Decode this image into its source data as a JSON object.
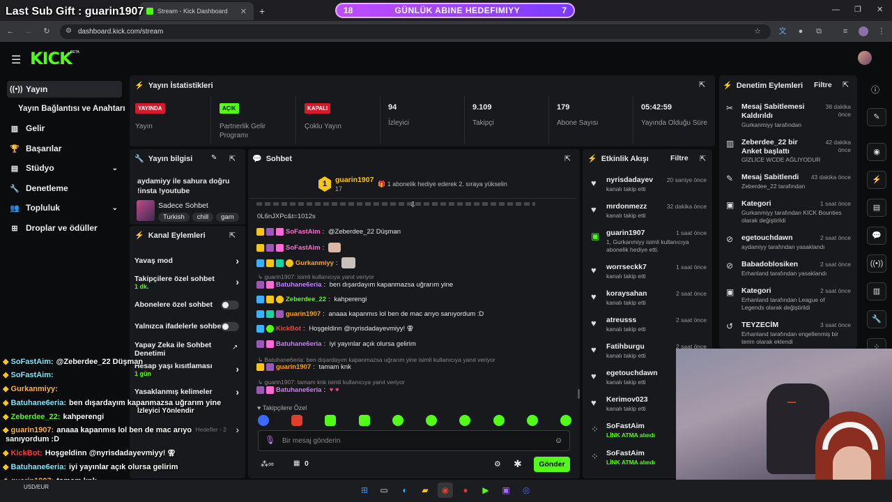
{
  "browser": {
    "tabs": [
      {
        "title": "Stream - Kick Dashboard"
      }
    ],
    "url": "dashboard.kick.com/stream"
  },
  "overlay": {
    "last_gift": "Last Sub Gift : guarin1907",
    "goal_left": "18",
    "goal_text": "GÜNLÜK ABINE HEDEFIMIYY",
    "goal_right": "7"
  },
  "header": {
    "logo": "KICK",
    "beta": "BETA"
  },
  "sidebar": {
    "items": [
      {
        "label": "Yayın"
      },
      {
        "label": "Yayın Bağlantısı ve Anahtarı"
      },
      {
        "label": "Gelir"
      },
      {
        "label": "Başarılar"
      },
      {
        "label": "Stüdyo"
      },
      {
        "label": "Denetleme"
      },
      {
        "label": "Topluluk"
      },
      {
        "label": "Droplar ve ödüller"
      }
    ]
  },
  "stats": {
    "title": "Yayın İstatistikleri",
    "cells": [
      {
        "badge": "YAYINDA",
        "label": "Yayın"
      },
      {
        "badge": "AÇIK",
        "label": "Partnerlik Gelir Programı"
      },
      {
        "badge": "KAPALI",
        "label": "Çoklu Yayın"
      },
      {
        "value": "94",
        "label": "İzleyici"
      },
      {
        "value": "9.109",
        "label": "Takipçi"
      },
      {
        "value": "179",
        "label": "Abone Sayısı"
      },
      {
        "value": "05:42:59",
        "label": "Yayında Olduğu Süre"
      }
    ]
  },
  "yayin_bilgisi": {
    "title": "Yayın bilgisi",
    "stream_title": "aydamiyy ile sahura doğru !insta !youtube",
    "category": "Sadece Sohbet",
    "tags": [
      "Turkish",
      "chill",
      "gam"
    ]
  },
  "kanal": {
    "title": "Kanal Eylemleri",
    "items": [
      {
        "label": "Yavaş mod"
      },
      {
        "label": "Takipçilere özel sohbet",
        "sub": "1 dk."
      },
      {
        "label": "Abonelere özel sohbet"
      },
      {
        "label": "Yalnızca ifadelerle sohbet"
      },
      {
        "label": "Yapay Zeka ile Sohbet Denetimi"
      },
      {
        "label": "Hesap yaşı kısıtlaması",
        "sub": "1 gün"
      },
      {
        "label": "Yasaklanmış kelimeler"
      },
      {
        "label": "Hedefler - 2"
      }
    ]
  },
  "chat": {
    "title": "Sohbet",
    "pinned_user": "guarin1907",
    "pinned_count": "17",
    "pinned_rank": "1",
    "pinned_msg": "1 abonelik hediye ederek 2. sıraya yükselin",
    "top_clip": "0L6nJXPc&t=1012s",
    "messages": [
      {
        "user": "SoFastAim",
        "color": "#ff6bd5",
        "text": "@Zeberdee_22 Düşman"
      },
      {
        "user": "SoFastAim",
        "color": "#ff6bd5",
        "text": ""
      },
      {
        "user": "Gurkanmiyy",
        "color": "#ff9f1a",
        "text": ""
      },
      {
        "reply": "guarin1907: isimli kullanıcıya yanıt veriyor"
      },
      {
        "user": "Batuhane6eria",
        "color": "#c77dff",
        "text": "ben dışardayım kapanmazsa uğrarım yine"
      },
      {
        "user": "Zeberdee_22",
        "color": "#53fc18",
        "text": "kahperengi"
      },
      {
        "user": "guarin1907",
        "color": "#ff9f1a",
        "text": "anaaa kapanmıs lol ben de mac arıyo sanıyordum :D"
      },
      {
        "user": "KickBot",
        "color": "#ff3b3b",
        "text": "Hoşgeldinn @nyrisdadayevmiyy! ⚢"
      },
      {
        "user": "Batuhane6eria",
        "color": "#c77dff",
        "text": "iyi yayınlar açık olursa gelirim"
      },
      {
        "reply": "Batuhane6eria: ben dışardayım kapanmazsa uğrarım yine isimli kullanıcıya yanıt veriyor"
      },
      {
        "user": "guarin1907",
        "color": "#ff9f1a",
        "text": "tamam knk"
      },
      {
        "reply": "guarin1907: tamam knk isimli kullanıcıya yanıt veriyor"
      },
      {
        "user": "Batuhane6eria",
        "color": "#c77dff",
        "text": "♥ ♥"
      }
    ],
    "followers_only": "Takipçilere Özel",
    "placeholder": "Bir mesaj gönderin",
    "points": "0",
    "send": "Gönder"
  },
  "activity": {
    "title": "Etkinlik Akışı",
    "filter": "Filtre",
    "items": [
      {
        "name": "nyrisdadayev",
        "sub": "kanalı takip etti",
        "time": "20 saniye önce",
        "icon": "heart"
      },
      {
        "name": "mrdonmezz",
        "sub": "kanalı takip etti",
        "time": "32 dakika önce",
        "icon": "heart"
      },
      {
        "name": "guarin1907",
        "sub": "1, Gurkanmiyy isimli kullanıcıya abonelik hediye etti.",
        "time": "1 saat önce",
        "icon": "gift"
      },
      {
        "name": "worrseckk7",
        "sub": "kanalı takip etti",
        "time": "1 saat önce",
        "icon": "heart"
      },
      {
        "name": "koraysahan",
        "sub": "kanalı takip etti",
        "time": "2 saat önce",
        "icon": "heart"
      },
      {
        "name": "atreusss",
        "sub": "kanalı takip etti",
        "time": "2 saat önce",
        "icon": "heart"
      },
      {
        "name": "Fatihburgu",
        "sub": "kanalı takip etti",
        "time": "2 saat önce",
        "icon": "heart"
      },
      {
        "name": "egetouchdawn",
        "sub": "kanalı takip etti",
        "time": "2",
        "icon": "heart"
      },
      {
        "name": "Kerimov023",
        "sub": "kanalı takip etti",
        "time": "2",
        "icon": "heart"
      },
      {
        "name": "SoFastAim",
        "sub": "LİNK ATMA alındı",
        "time": "",
        "icon": "dots"
      },
      {
        "name": "SoFastAim",
        "sub": "LİNK ATMA alındı",
        "time": "",
        "icon": "dots"
      }
    ]
  },
  "moderation": {
    "title": "Denetim Eylemleri",
    "filter": "Filtre",
    "items": [
      {
        "name": "Mesaj Sabitlemesi Kaldırıldı",
        "sub": "Gurkanmiyy tarafından",
        "time": "38 dakika önce"
      },
      {
        "name": "Zeberdee_22 bir Anket başlattı",
        "sub": "GİZLİCE WCDE AĞLIYODUR",
        "time": "42 dakika önce"
      },
      {
        "name": "Mesaj Sabitlendi",
        "sub": "Zeberdee_22 tarafından",
        "time": "43 dakika önce"
      },
      {
        "name": "Kategori",
        "sub": "Gurkanmiyy tarafından KICK Bounties olarak değiştirildi",
        "time": "1 saat önce"
      },
      {
        "name": "egetouchdawn",
        "sub": "aydamiyy tarafından yasaklandı",
        "time": "2 saat önce"
      },
      {
        "name": "Babadoblosiken",
        "sub": "Erhanland tarafından yasaklandı",
        "time": "2 saat önce"
      },
      {
        "name": "Kategori",
        "sub": "Erhanland tarafından League of Legends olarak değiştirildi",
        "time": "2 saat önce"
      },
      {
        "name": "TEYZECİM",
        "sub": "Erhanland tarafından engellenmiş bir terim olarak eklendi",
        "time": "3 saat önce"
      }
    ]
  },
  "overlay_chat": [
    {
      "user": "SoFastAim:",
      "color": "#7ee8ff",
      "text": "@Zeberdee_22 Düşman"
    },
    {
      "user": "SoFastAim:",
      "color": "#7ee8ff",
      "text": ""
    },
    {
      "user": "Gurkanmiyy:",
      "color": "#ffb347",
      "text": ""
    },
    {
      "user": "Batuhane6eria:",
      "color": "#7ee8ff",
      "text": "ben dışardayım kapanmazsa uğrarım yine"
    },
    {
      "user": "",
      "color": "#fff",
      "text": "İzleyici Yönlendir"
    },
    {
      "user": "Zeberdee_22:",
      "color": "#53fc18",
      "text": "kahperengi"
    },
    {
      "user": "guarin1907:",
      "color": "#ffb347",
      "text": "anaaa kapanmıs lol ben de mac arıyo"
    },
    {
      "user": "",
      "color": "#fff",
      "text": "sanıyordum :D"
    },
    {
      "user": "KickBot:",
      "color": "#ff3b3b",
      "text": "Hoşgeldinn @nyrisdadayevmiyy! ⚢"
    },
    {
      "user": "Batuhane6eria:",
      "color": "#7ee8ff",
      "text": "iyi yayınlar açık olursa gelirim"
    },
    {
      "user": "guarin1907:",
      "color": "#ffb347",
      "text": "tamam knk"
    },
    {
      "user": "Batuhane6eria:",
      "color": "#7ee8ff",
      "text": "♥ ♥"
    }
  ],
  "taskbar": {
    "ticker": "USD/EUR"
  }
}
